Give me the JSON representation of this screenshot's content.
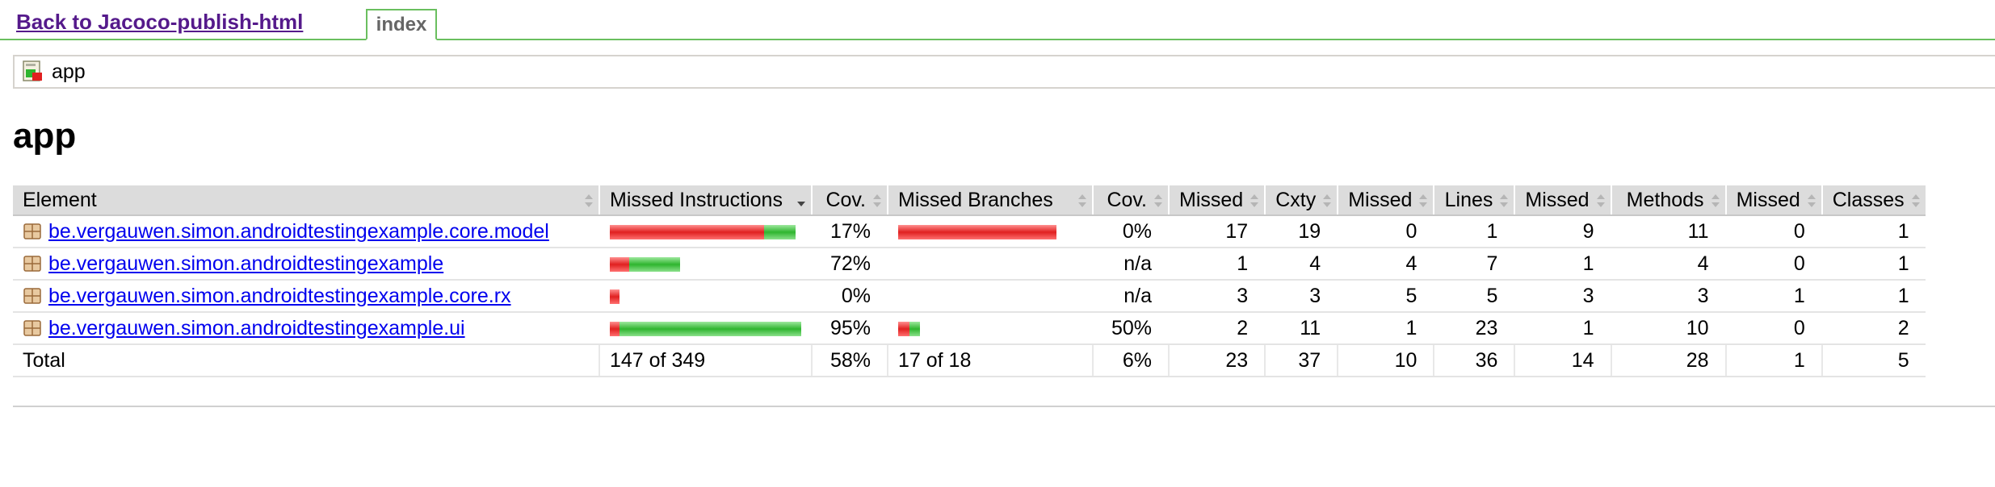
{
  "nav": {
    "back_link": "Back to Jacoco-publish-html",
    "tab_index": "index"
  },
  "breadcrumb": {
    "label": "app"
  },
  "page": {
    "title": "app"
  },
  "colors": {
    "missed_bar": "#e02020",
    "covered_bar": "#2fb52f",
    "accent_border": "#6abf5f",
    "link": "#0000ee",
    "visited_link": "#551a8b"
  },
  "table": {
    "headers": {
      "element": "Element",
      "missed_instructions": "Missed Instructions",
      "instr_cov": "Cov.",
      "missed_branches": "Missed Branches",
      "branch_cov": "Cov.",
      "missed_cxty": "Missed",
      "cxty": "Cxty",
      "missed_lines": "Missed",
      "lines": "Lines",
      "missed_methods": "Missed",
      "methods": "Methods",
      "missed_classes": "Missed",
      "classes": "Classes"
    },
    "rows": [
      {
        "element": "be.vergauwen.simon.androidtestingexample.core.model",
        "instr_missed_fraction": 0.83,
        "instr_bar_scale": 1.0,
        "instr_cov": "17%",
        "branch_missed_fraction": 1.0,
        "branch_bar_scale": 1.0,
        "branch_cov": "0%",
        "missed_cxty": "17",
        "cxty": "19",
        "missed_lines": "0",
        "lines": "1",
        "missed_methods": "9",
        "methods": "11",
        "missed_classes": "0",
        "classes": "1"
      },
      {
        "element": "be.vergauwen.simon.androidtestingexample",
        "instr_missed_fraction": 0.28,
        "instr_bar_scale": 0.38,
        "instr_cov": "72%",
        "branch_missed_fraction": null,
        "branch_bar_scale": 0,
        "branch_cov": "n/a",
        "missed_cxty": "1",
        "cxty": "4",
        "missed_lines": "4",
        "lines": "7",
        "missed_methods": "1",
        "methods": "4",
        "missed_classes": "0",
        "classes": "1"
      },
      {
        "element": "be.vergauwen.simon.androidtestingexample.core.rx",
        "instr_missed_fraction": 1.0,
        "instr_bar_scale": 0.05,
        "instr_cov": "0%",
        "branch_missed_fraction": null,
        "branch_bar_scale": 0,
        "branch_cov": "n/a",
        "missed_cxty": "3",
        "cxty": "3",
        "missed_lines": "5",
        "lines": "5",
        "missed_methods": "3",
        "methods": "3",
        "missed_classes": "1",
        "classes": "1"
      },
      {
        "element": "be.vergauwen.simon.androidtestingexample.ui",
        "instr_missed_fraction": 0.05,
        "instr_bar_scale": 1.03,
        "instr_cov": "95%",
        "branch_missed_fraction": 0.5,
        "branch_bar_scale": 0.14,
        "branch_cov": "50%",
        "missed_cxty": "2",
        "cxty": "11",
        "missed_lines": "1",
        "lines": "23",
        "missed_methods": "1",
        "methods": "10",
        "missed_classes": "0",
        "classes": "2"
      }
    ],
    "total": {
      "label": "Total",
      "missed_instructions": "147 of 349",
      "instr_cov": "58%",
      "missed_branches": "17 of 18",
      "branch_cov": "6%",
      "missed_cxty": "23",
      "cxty": "37",
      "missed_lines": "10",
      "lines": "36",
      "missed_methods": "14",
      "methods": "28",
      "missed_classes": "1",
      "classes": "5"
    }
  }
}
